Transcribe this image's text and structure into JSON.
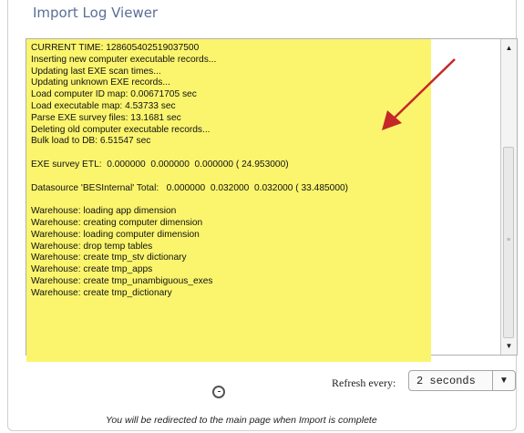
{
  "panel": {
    "title": "Import Log Viewer"
  },
  "log": {
    "lines": [
      "CURRENT TIME: 128605402519037500",
      "Inserting new computer executable records...",
      "Updating last EXE scan times...",
      "Updating unknown EXE records...",
      "Load computer ID map: 0.00671705 sec",
      "Load executable map: 4.53733 sec",
      "Parse EXE survey files: 13.1681 sec",
      "Deleting old computer executable records...",
      "Bulk load to DB: 6.51547 sec",
      "",
      "EXE survey ETL:  0.000000  0.000000  0.000000 ( 24.953000)",
      "",
      "Datasource 'BESInternal' Total:   0.000000  0.032000  0.032000 ( 33.485000)",
      "",
      "Warehouse: loading app dimension",
      "Warehouse: creating computer dimension",
      "Warehouse: loading computer dimension",
      "Warehouse: drop temp tables",
      "Warehouse: create tmp_stv dictionary",
      "Warehouse: create tmp_apps",
      "Warehouse: create tmp_unambiguous_exes",
      "Warehouse: create tmp_dictionary"
    ],
    "highlight_color": "#fbf56e",
    "annotation_arrow_color": "#c62828"
  },
  "refresh": {
    "label": "Refresh every:",
    "selected": "2 seconds"
  },
  "footer": {
    "message": "You will be redirected to the main page when Import is complete"
  },
  "icons": {
    "scroll_up": "scroll-up-icon",
    "scroll_down": "scroll-down-icon",
    "dropdown": "chevron-down-icon",
    "spinner": "loading-spinner-icon"
  }
}
